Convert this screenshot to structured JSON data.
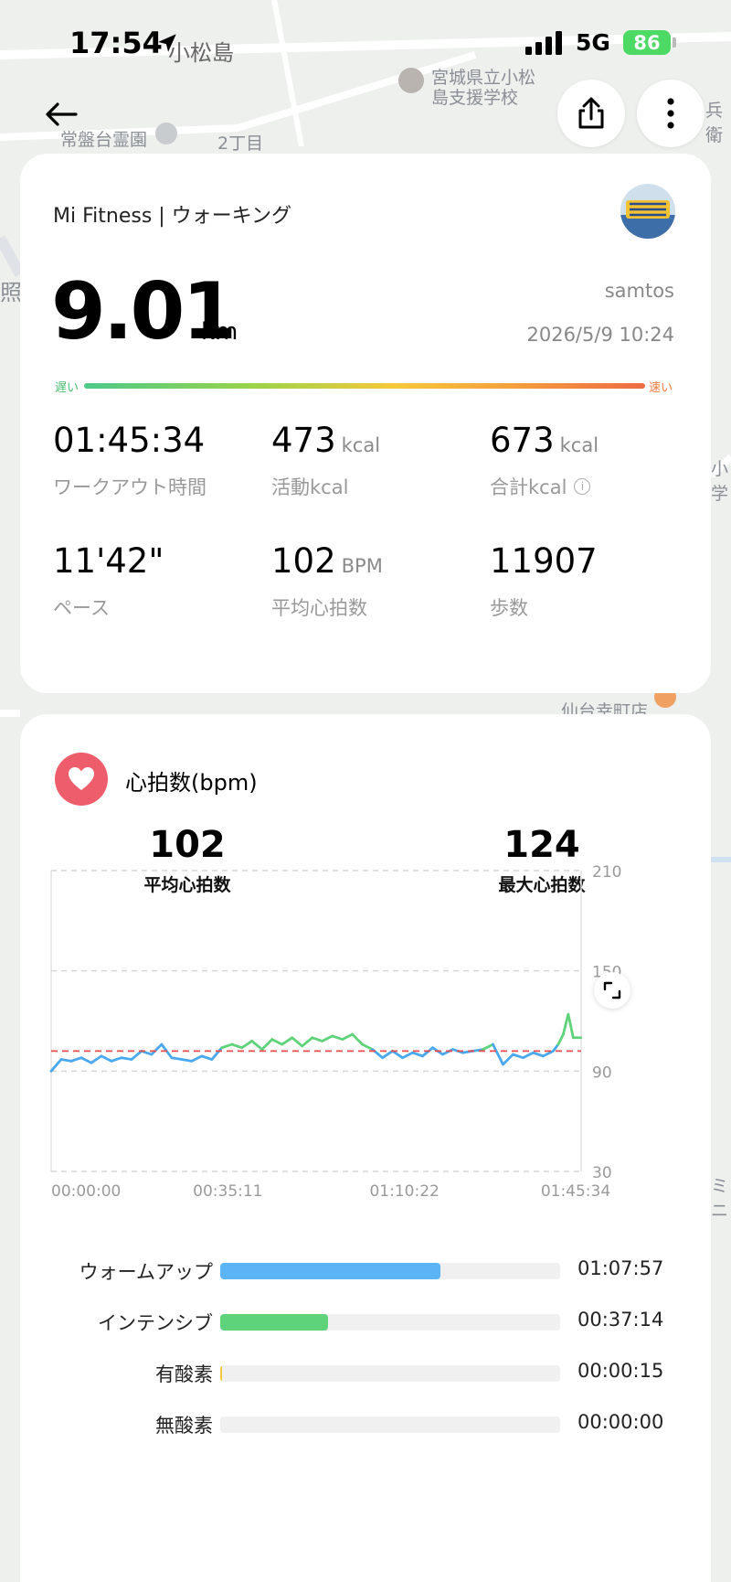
{
  "status_bar": {
    "time": "17:54",
    "network": "5G",
    "battery": "86"
  },
  "map": {
    "labels": [
      "小松島",
      "宮城県立小松",
      "島支援学校",
      "常盤台霊園",
      "2丁目",
      "仙台幸町店",
      "照",
      "兵衛",
      "小学",
      "ミニ"
    ]
  },
  "summary": {
    "app_title": "Mi Fitness | ウォーキング",
    "distance": "9.01",
    "distance_unit": "km",
    "username": "samtos",
    "datetime": "2026/5/9 10:24",
    "speed_slow": "遅い",
    "speed_fast": "速い",
    "stats": [
      {
        "value": "01:45:34",
        "unit": "",
        "label": "ワークアウト時間",
        "info": false
      },
      {
        "value": "473",
        "unit": "kcal",
        "label": "活動kcal",
        "info": false
      },
      {
        "value": "673",
        "unit": "kcal",
        "label": "合計kcal",
        "info": true
      },
      {
        "value": "11'42\"",
        "unit": "",
        "label": "ペース",
        "info": false
      },
      {
        "value": "102",
        "unit": "BPM",
        "label": "平均心拍数",
        "info": false
      },
      {
        "value": "11907",
        "unit": "",
        "label": "歩数",
        "info": false
      }
    ]
  },
  "heart_rate": {
    "title": "心拍数(bpm)",
    "avg_value": "102",
    "avg_label": "平均心拍数",
    "max_value": "124",
    "max_label": "最大心拍数",
    "zones": [
      {
        "name": "ウォームアップ",
        "time": "01:07:57",
        "fraction": 0.648,
        "color": "#5ab4f5"
      },
      {
        "name": "インテンシブ",
        "time": "00:37:14",
        "fraction": 0.318,
        "color": "#5fd37a"
      },
      {
        "name": "有酸素",
        "time": "00:00:15",
        "fraction": 0.003,
        "color": "#f5c93a"
      },
      {
        "name": "無酸素",
        "time": "00:00:00",
        "fraction": 0.0,
        "color": "#ee6b45"
      }
    ]
  },
  "chart_data": {
    "type": "line",
    "ylim": [
      30,
      210
    ],
    "y_ticks": [
      210,
      150,
      90,
      30
    ],
    "x_ticks": [
      "00:00:00",
      "00:35:11",
      "01:10:22",
      "01:45:34"
    ],
    "x_range_minutes": [
      0,
      105.57
    ],
    "average_line": 102,
    "series": [
      {
        "x": [
          0,
          2,
          4,
          6,
          8,
          10,
          12,
          14,
          16,
          18,
          20,
          22,
          24,
          26,
          28,
          30,
          32,
          34,
          36,
          38,
          40,
          42,
          44,
          46,
          48,
          50,
          52,
          54,
          56,
          58,
          60,
          62,
          64,
          66,
          68,
          70,
          72,
          74,
          76,
          78,
          80,
          82,
          84,
          86,
          88,
          90,
          92,
          94,
          96,
          98,
          100,
          101,
          102,
          103,
          104,
          105.5
        ],
        "values": [
          90,
          97,
          96,
          98,
          95,
          99,
          96,
          98,
          97,
          102,
          100,
          106,
          98,
          97,
          96,
          99,
          97,
          104,
          106,
          104,
          108,
          103,
          109,
          106,
          110,
          105,
          110,
          108,
          111,
          109,
          112,
          106,
          103,
          98,
          102,
          98,
          101,
          99,
          104,
          100,
          103,
          101,
          102,
          103,
          106,
          94,
          100,
          98,
          101,
          99,
          102,
          106,
          112,
          124,
          110,
          110
        ]
      }
    ]
  }
}
